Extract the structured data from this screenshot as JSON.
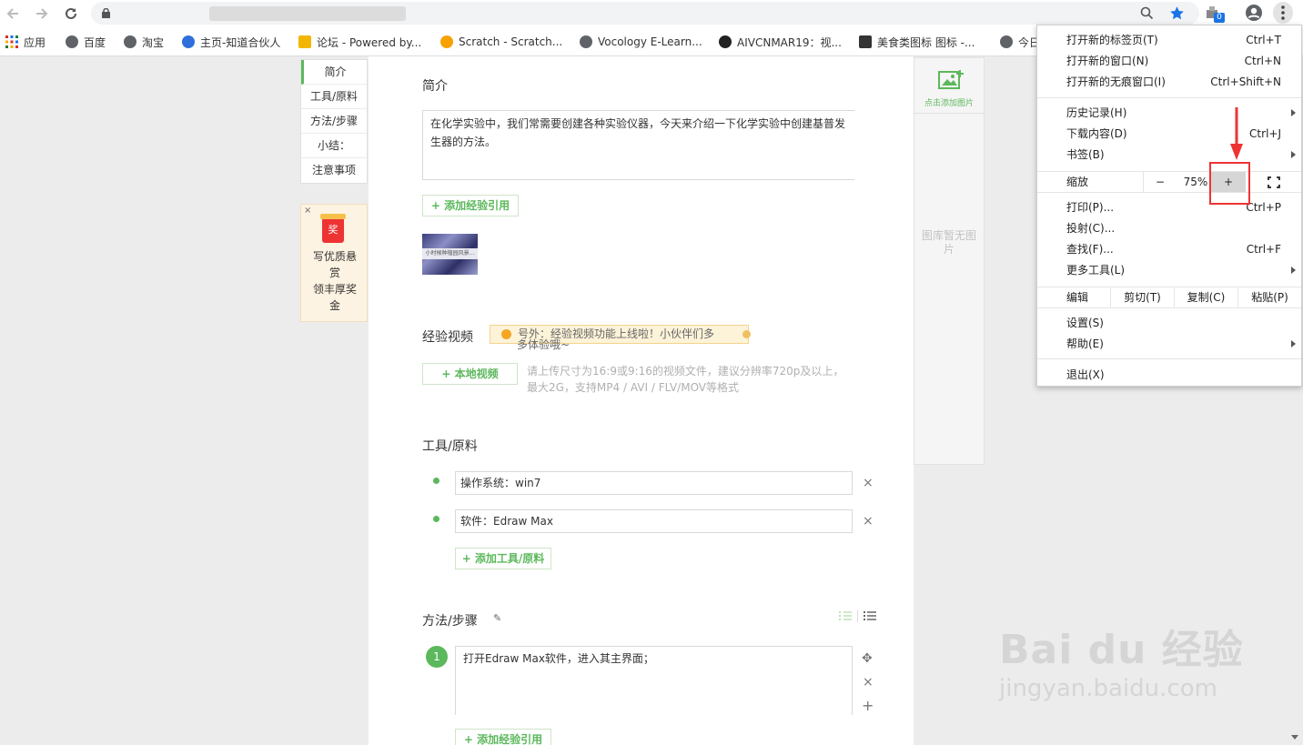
{
  "browser": {
    "bookmarks": [
      {
        "label": "应用",
        "icon": "apps-grid-icon"
      },
      {
        "label": "百度",
        "icon": "globe-icon"
      },
      {
        "label": "淘宝",
        "icon": "globe-icon"
      },
      {
        "label": "主页-知道合伙人",
        "icon": "paw-icon"
      },
      {
        "label": "论坛 - Powered by...",
        "icon": "trophy-icon"
      },
      {
        "label": "Scratch - Scratch...",
        "icon": "scratch-icon"
      },
      {
        "label": "Vocology E-Learn...",
        "icon": "globe-icon"
      },
      {
        "label": "AIVCNMAR19：视...",
        "icon": "logo-icon"
      },
      {
        "label": "美食类图标 图标 -...",
        "icon": "figure-icon"
      },
      {
        "label": "今日",
        "icon": "globe-icon"
      }
    ],
    "extension_badge": "0",
    "colors": {
      "star": "#1a73e8",
      "accent": "#5cb85c"
    }
  },
  "leftnav": {
    "items": [
      "简介",
      "工具/原料",
      "方法/步骤",
      "小结：",
      "注意事项"
    ],
    "reward": {
      "close": "×",
      "gift": "奖",
      "line1": "写优质悬",
      "line2": "赏",
      "line3": "领丰厚奖",
      "line4": "金"
    }
  },
  "intro": {
    "heading": "简介",
    "text": "在化学实验中，我们常需要创建各种实验仪器，今天来介绍一下化学实验中创建基普发生器的方法。",
    "add_ref": "+ 添加经验引用",
    "thumb_caption": "小时候种植园风景..."
  },
  "video": {
    "heading": "经验视频",
    "tip_line1": "号外：经验视频功能上线啦！小伙伴们多",
    "tip_line2": "多体验哦~",
    "upload_button": "+ 本地视频",
    "hint": "请上传尺寸为16:9或9:16的视频文件，建议分辨率720p及以上，最大2G，支持MP4 / AVI / FLV/MOV等格式"
  },
  "tools": {
    "heading": "工具/原料",
    "items": [
      "操作系统：win7",
      "软件：Edraw Max"
    ],
    "remove": "×",
    "add": "+ 添加工具/原料"
  },
  "steps": {
    "heading": "方法/步骤",
    "edit": "✎",
    "step_num": "1",
    "step_text": "打开Edraw Max软件，进入其主界面；",
    "move": "✥",
    "remove": "×",
    "add": "+",
    "add_ref": "+ 添加经验引用"
  },
  "rightpanel": {
    "add_image": "点击添加图片",
    "empty": "图库暂无图片"
  },
  "watermark": {
    "brand": "Bai du 经验",
    "url": "jingyan.baidu.com"
  },
  "menu": {
    "new_tab": "打开新的标签页(T)",
    "new_tab_sc": "Ctrl+T",
    "new_window": "打开新的窗口(N)",
    "new_window_sc": "Ctrl+N",
    "incognito": "打开新的无痕窗口(I)",
    "incognito_sc": "Ctrl+Shift+N",
    "history": "历史记录(H)",
    "downloads": "下载内容(D)",
    "downloads_sc": "Ctrl+J",
    "bookmarks": "书签(B)",
    "zoom": "缩放",
    "zoom_minus": "−",
    "zoom_level": "75%",
    "zoom_plus": "+",
    "print": "打印(P)...",
    "print_sc": "Ctrl+P",
    "cast": "投射(C)...",
    "find": "查找(F)...",
    "find_sc": "Ctrl+F",
    "more_tools": "更多工具(L)",
    "edit": "编辑",
    "cut": "剪切(T)",
    "copy": "复制(C)",
    "paste": "粘贴(P)",
    "settings": "设置(S)",
    "help": "帮助(E)",
    "exit": "退出(X)"
  }
}
